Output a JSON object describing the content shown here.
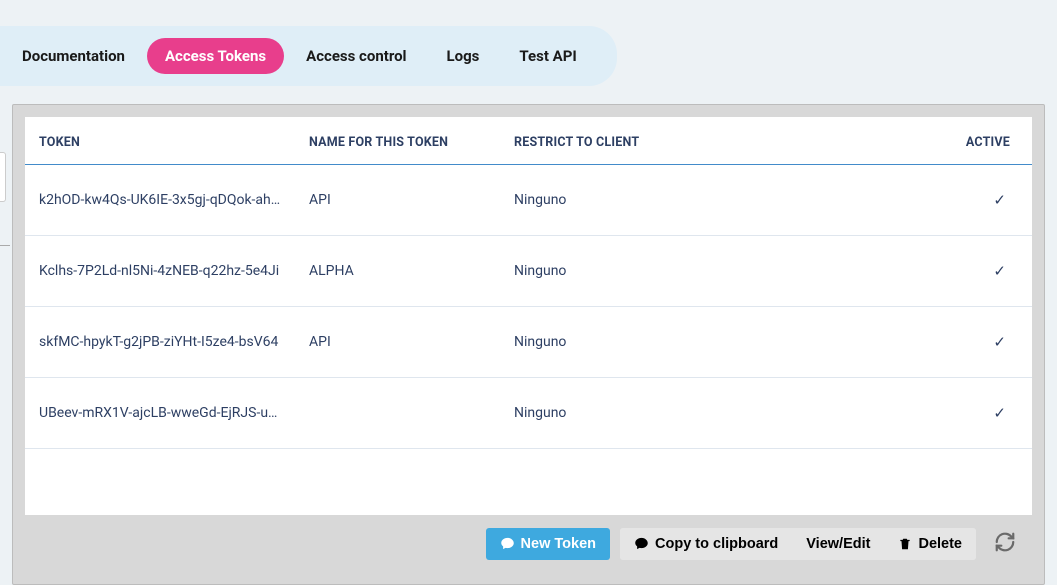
{
  "tabs": {
    "documentation": "Documentation",
    "access_tokens": "Access Tokens",
    "access_control": "Access control",
    "logs": "Logs",
    "test_api": "Test API"
  },
  "table": {
    "headers": {
      "token": "TOKEN",
      "name": "NAME FOR THIS TOKEN",
      "client": "RESTRICT TO CLIENT",
      "active": "ACTIVE"
    },
    "rows": [
      {
        "token": "k2hOD-kw4Qs-UK6IE-3x5gj-qDQok-ah…",
        "name": "API",
        "client": "Ninguno",
        "active": "✓"
      },
      {
        "token": "Kclhs-7P2Ld-nl5Ni-4zNEB-q22hz-5e4Ji",
        "name": "ALPHA",
        "client": "Ninguno",
        "active": "✓"
      },
      {
        "token": "skfMC-hpykT-g2jPB-ziYHt-I5ze4-bsV64",
        "name": "API",
        "client": "Ninguno",
        "active": "✓"
      },
      {
        "token": "UBeev-mRX1V-ajcLB-wweGd-EjRJS-u0…",
        "name": "",
        "client": "Ninguno",
        "active": "✓"
      }
    ]
  },
  "footer": {
    "new_token": "New Token",
    "copy": "Copy to clipboard",
    "view_edit": "View/Edit",
    "delete": "Delete"
  }
}
